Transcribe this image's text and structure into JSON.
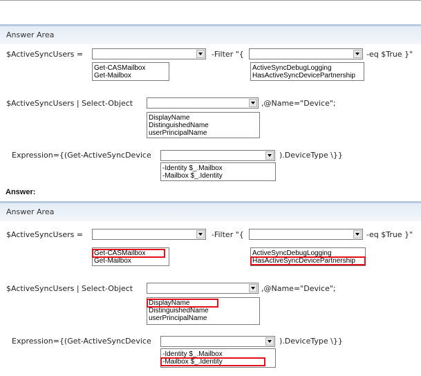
{
  "question": {
    "area_title": "Answer Area",
    "line1_prefix": "$ActiveSyncUsers =",
    "line1_filter": "-Filter \"{",
    "line1_suffix": "-eq $True }\"",
    "dropdown1_options": [
      "Get-CASMailbox",
      "Get-Mailbox"
    ],
    "dropdown2_options": [
      "ActiveSyncDebugLogging",
      "HasActiveSyncDevicePartnership"
    ],
    "line2_prefix": "$ActiveSyncUsers | Select-Object",
    "line2_suffix": ",@Name=\"Device\";",
    "dropdown3_options": [
      "DisplayName",
      "DistinguishedName",
      "userPrincipalName"
    ],
    "line3_prefix": "Expression={(Get-ActiveSyncDevice",
    "line3_suffix": ").DeviceType \\}}",
    "dropdown4_options": [
      "-Identity $_.Mailbox",
      "-Mailbox $_.Identity"
    ]
  },
  "answer_label": "Answer:",
  "answer": {
    "area_title": "Answer Area",
    "line1_prefix": "$ActiveSyncUsers =",
    "line1_filter": "-Filter \"{",
    "line1_suffix": "-eq $True }\"",
    "dropdown1_options": [
      "Get-CASMailbox",
      "Get-Mailbox"
    ],
    "dropdown2_options": [
      "ActiveSyncDebugLogging",
      "HasActiveSyncDevicePartnership"
    ],
    "line2_prefix": "$ActiveSyncUsers | Select-Object",
    "line2_suffix": ",@Name=\"Device\";",
    "dropdown3_options": [
      "DisplayName",
      "DistinguishedName",
      "userPrincipalName"
    ],
    "line3_prefix": "Expression={(Get-ActiveSyncDevice",
    "line3_suffix": ").DeviceType \\}}",
    "dropdown4_options": [
      "-Identity $_.Mailbox",
      "-Mailbox $_.Identity"
    ],
    "highlight_color": "#e3101a"
  }
}
